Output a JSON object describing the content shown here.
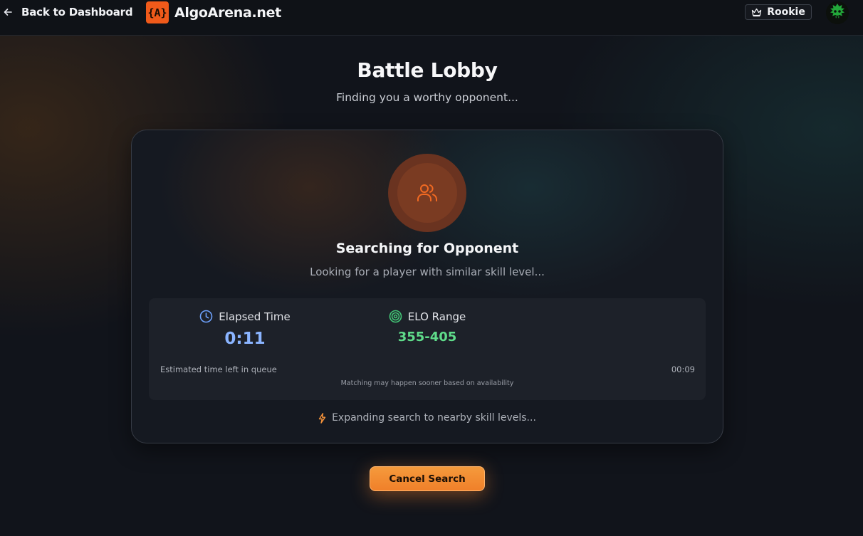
{
  "nav": {
    "back_label": "Back to Dashboard",
    "logo_text": "{A}",
    "brand_name": "AlgoArena.net",
    "rank": "Rookie"
  },
  "header": {
    "title": "Battle Lobby",
    "subtitle": "Finding you a worthy opponent..."
  },
  "search": {
    "title": "Searching for Opponent",
    "subtitle": "Looking for a player with similar skill level...",
    "elapsed_label": "Elapsed Time",
    "elapsed_value": "0:11",
    "elo_label": "ELO Range",
    "elo_value": "355-405",
    "eta_label": "Estimated time left in queue",
    "eta_value": "00:09",
    "eta_note": "Matching may happen sooner based on availability",
    "expanding_text": "Expanding search to nearby skill levels..."
  },
  "actions": {
    "cancel_label": "Cancel Search"
  },
  "colors": {
    "brand": "#f05a1a",
    "accent": "#f0802a",
    "time": "#8ab4ff",
    "elo": "#5fdc8a"
  },
  "icons": {
    "back": "arrow-left-icon",
    "rank": "crown-icon",
    "search": "users-icon",
    "elapsed": "clock-icon",
    "elo": "target-icon",
    "expanding": "lightning-icon"
  }
}
